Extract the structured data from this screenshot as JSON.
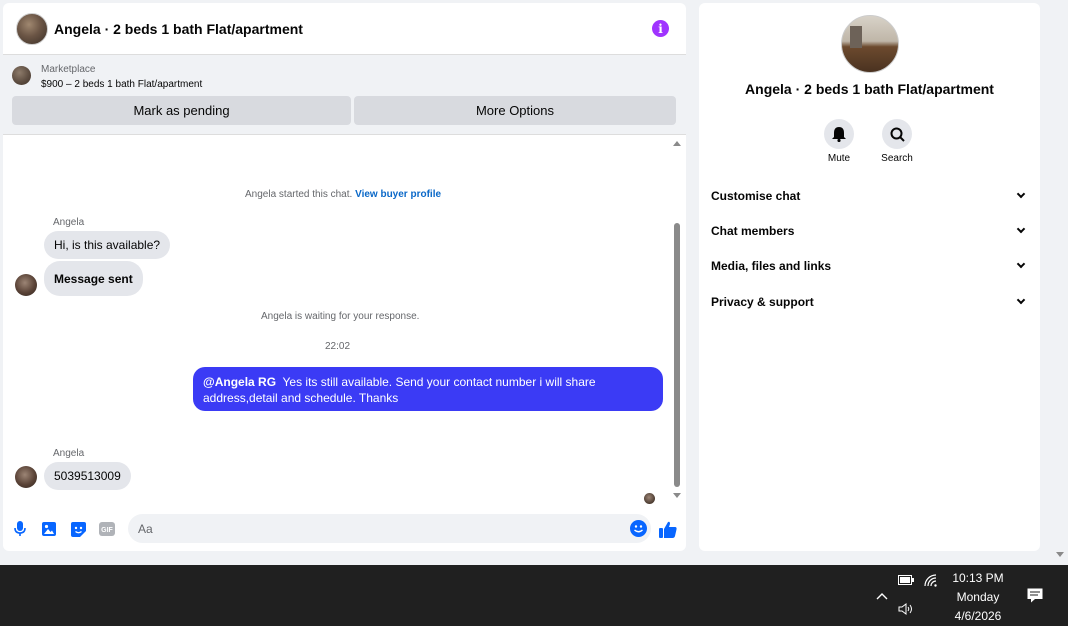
{
  "chat": {
    "title": "Angela · 2 beds 1 bath Flat/apartment",
    "info_icon": "info-icon",
    "marketplace": {
      "label": "Marketplace",
      "listing": "$900 – 2 beds 1 bath Flat/apartment",
      "pending_button": "Mark as pending",
      "more_button": "More Options"
    },
    "messages": {
      "started_text": "Angela started this chat.",
      "view_profile": "View buyer profile",
      "sender1": "Angela",
      "msg1": "Hi, is this available?",
      "msg2": "Message sent",
      "waiting_text": "Angela is waiting for your response.",
      "time": "22:02",
      "reply_mention": "@Angela RG",
      "reply_text": "Yes its still available. Send your contact number i will share address,detail and schedule. Thanks",
      "sender2": "Angela",
      "msg3": "5039513009"
    },
    "composer": {
      "placeholder": "Aa",
      "icons": [
        "microphone-icon",
        "image-icon",
        "sticker-icon",
        "gif-icon",
        "emoji-icon",
        "like-icon"
      ],
      "gif_label": "GIF"
    }
  },
  "info": {
    "name": "Angela · 2 beds 1 bath Flat/apartment",
    "mute_label": "Mute",
    "search_label": "Search",
    "sections": [
      "Customise chat",
      "Chat members",
      "Media, files and links",
      "Privacy & support"
    ]
  },
  "taskbar": {
    "time": "10:13 PM",
    "day": "Monday",
    "date": "4/6/2026",
    "icons": [
      "chevron-up-icon",
      "battery-icon",
      "wifi-icon",
      "speaker-icon",
      "notification-icon"
    ]
  },
  "colors": {
    "accent": "#0866ff",
    "outgoing_bubble": "#3b3bf5",
    "info_purple": "#a033ff",
    "link": "#0a68c8"
  }
}
